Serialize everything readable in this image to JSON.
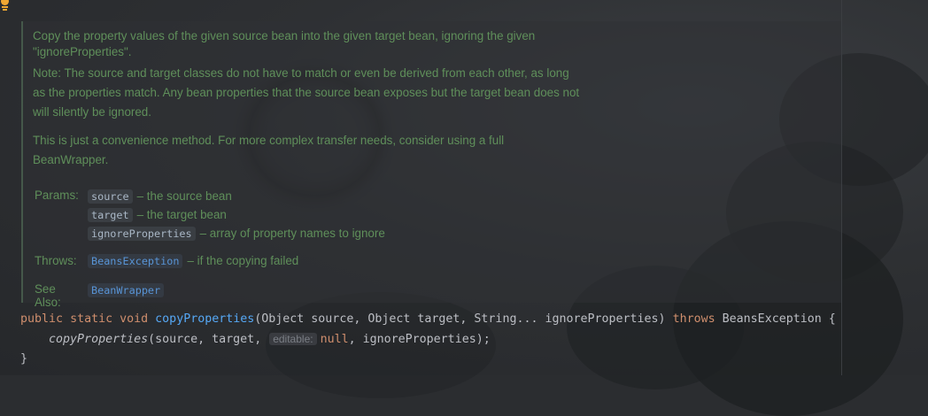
{
  "editor": {
    "accent_colors": {
      "doc_text": "#5f8f5a",
      "keyword": "#cf8e6d",
      "method": "#56a8f5",
      "link": "#5894d6",
      "code_text": "#bcbec4",
      "inlay_hint": "#7a7e85"
    },
    "gutter_icon": "lightbulb-icon"
  },
  "doc": {
    "p1": "Copy the property values of the given source bean into the given target bean, ignoring the given \"ignoreProperties\".",
    "p2": "Note: The source and target classes do not have to match or even be derived from each other, as long as the properties match. Any bean properties that the source bean exposes but the target bean does not will silently be ignored.",
    "p3": "This is just a convenience method. For more complex transfer needs, consider using a full BeanWrapper.",
    "params_label": "Params:",
    "params": [
      {
        "name": "source",
        "desc": "– the source bean"
      },
      {
        "name": "target",
        "desc": "– the target bean"
      },
      {
        "name": "ignoreProperties",
        "desc": "– array of property names to ignore"
      }
    ],
    "throws_label": "Throws:",
    "throws": {
      "name": "BeansException",
      "desc": "– if the copying failed"
    },
    "see_label": "See Also:",
    "see": "BeanWrapper"
  },
  "code": {
    "kw_public": "public",
    "kw_static": "static",
    "kw_void": "void",
    "method_name": "copyProperties",
    "params_text": "(Object source, Object target, String... ignoreProperties)",
    "kw_throws": "throws",
    "exception": "BeansException {",
    "call_name": "copyProperties",
    "call_args_start": "(source, target, ",
    "inlay_hint": "editable:",
    "kw_null": "null",
    "call_args_end": ", ignoreProperties);",
    "closing": "}"
  }
}
